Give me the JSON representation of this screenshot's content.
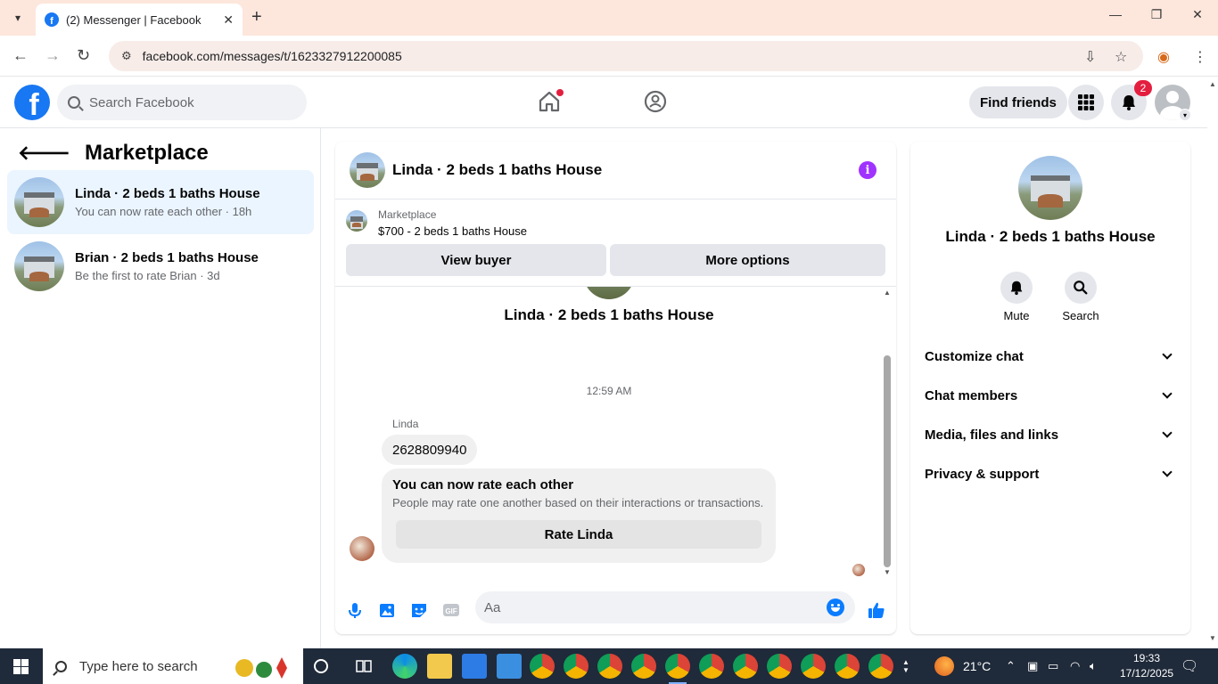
{
  "browser": {
    "tab_title": "(2) Messenger | Facebook",
    "url": "facebook.com/messages/t/1623327912200085"
  },
  "header": {
    "search_placeholder": "Search Facebook",
    "find_friends": "Find friends",
    "notification_count": "2"
  },
  "sidebar": {
    "title": "Marketplace",
    "conversations": [
      {
        "name": "Linda · 2 beds 1 baths House",
        "preview": "You can now rate each other",
        "time": "18h"
      },
      {
        "name": "Brian · 2 beds 1 baths House",
        "preview": "Be the first to rate Brian",
        "time": "3d"
      }
    ]
  },
  "chat": {
    "title": "Linda · 2 beds 1 baths House",
    "marketplace_label": "Marketplace",
    "listing": "$700 - 2 beds 1 baths House",
    "view_buyer": "View buyer",
    "more_options": "More options",
    "thread_name": "Linda · 2 beds 1 baths House",
    "timestamp": "12:59 AM",
    "sender": "Linda",
    "message": "2628809940",
    "rate_title": "You can now rate each other",
    "rate_desc": "People may rate one another based on their interactions or transactions.",
    "rate_button": "Rate Linda",
    "composer_placeholder": "Aa"
  },
  "details": {
    "name": "Linda · 2 beds 1 baths House",
    "mute": "Mute",
    "search": "Search",
    "sections": [
      "Customize chat",
      "Chat members",
      "Media, files and links",
      "Privacy & support"
    ]
  },
  "taskbar": {
    "search_placeholder": "Type here to search",
    "weather": "21°C",
    "time": "19:33",
    "date": "17/12/2025"
  },
  "colors": {
    "accent": "#1877f2",
    "messenger_blue": "#0a7cff",
    "info_purple": "#a033ff",
    "badge_red": "#e41e3f"
  }
}
